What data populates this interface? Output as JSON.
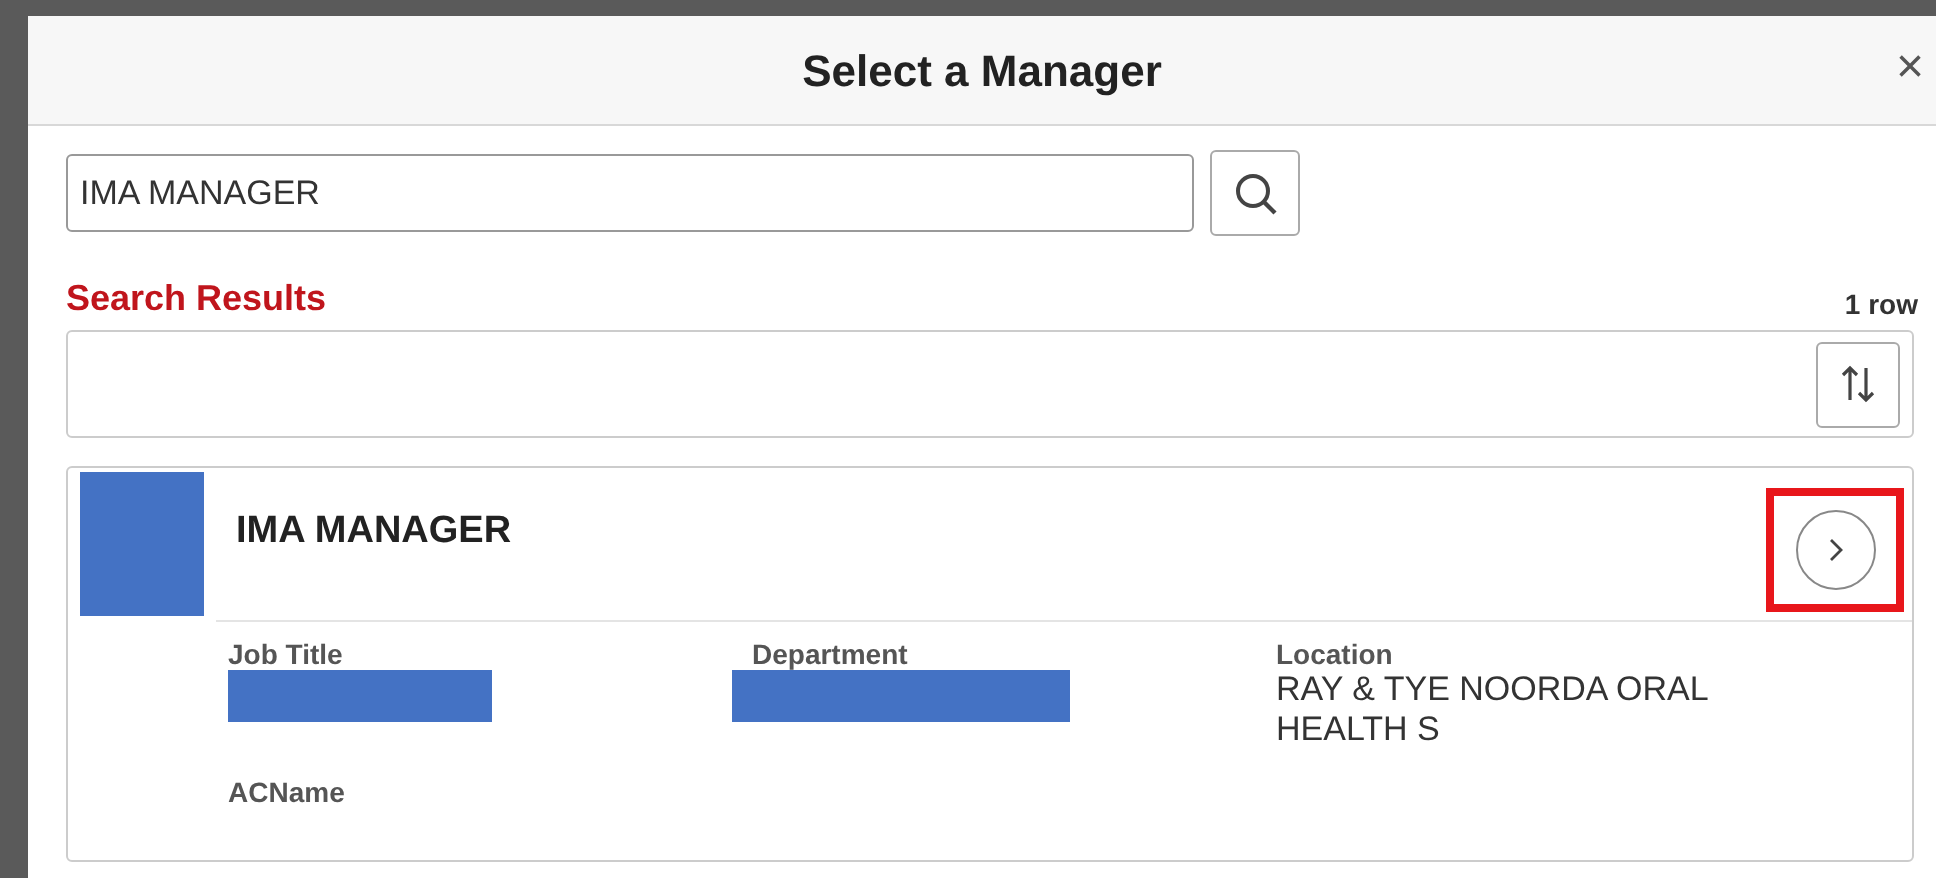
{
  "dialog": {
    "title": "Select a Manager",
    "close_label": "×"
  },
  "search": {
    "value": "IMA MANAGER"
  },
  "results": {
    "heading": "Search Results",
    "count": "1 row"
  },
  "cards": [
    {
      "name": "IMA MANAGER",
      "photo_redacted": true,
      "open_highlighted": true,
      "fields": [
        {
          "label": "Job Title",
          "kind": "redacted"
        },
        {
          "label": "Department",
          "kind": "redacted"
        },
        {
          "label": "Location",
          "kind": "text",
          "value": "RAY & TYE NOORDA ORAL HEALTH S"
        },
        {
          "label": "ACName",
          "kind": "empty"
        }
      ]
    }
  ]
}
